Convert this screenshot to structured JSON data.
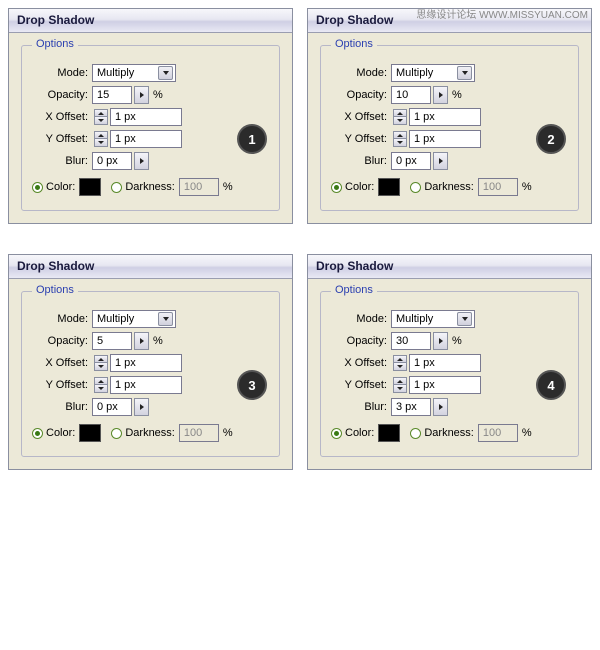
{
  "watermark": "思缘设计论坛  WWW.MISSYUAN.COM",
  "labels": {
    "title": "Drop Shadow",
    "options": "Options",
    "mode": "Mode:",
    "opacity": "Opacity:",
    "xoffset": "X Offset:",
    "yoffset": "Y Offset:",
    "blur": "Blur:",
    "color": "Color:",
    "darkness": "Darkness:",
    "percent": "%"
  },
  "panels": [
    {
      "badge": "1",
      "mode": "Multiply",
      "opacity": "15",
      "xoffset": "1 px",
      "yoffset": "1 px",
      "blur": "0 px",
      "darkness": "100",
      "colorChecked": true
    },
    {
      "badge": "2",
      "mode": "Multiply",
      "opacity": "10",
      "xoffset": "1 px",
      "yoffset": "1 px",
      "blur": "0 px",
      "darkness": "100",
      "colorChecked": true
    },
    {
      "badge": "3",
      "mode": "Multiply",
      "opacity": "5",
      "xoffset": "1 px",
      "yoffset": "1 px",
      "blur": "0 px",
      "darkness": "100",
      "colorChecked": true
    },
    {
      "badge": "4",
      "mode": "Multiply",
      "opacity": "30",
      "xoffset": "1 px",
      "yoffset": "1 px",
      "blur": "3 px",
      "darkness": "100",
      "colorChecked": true
    }
  ]
}
